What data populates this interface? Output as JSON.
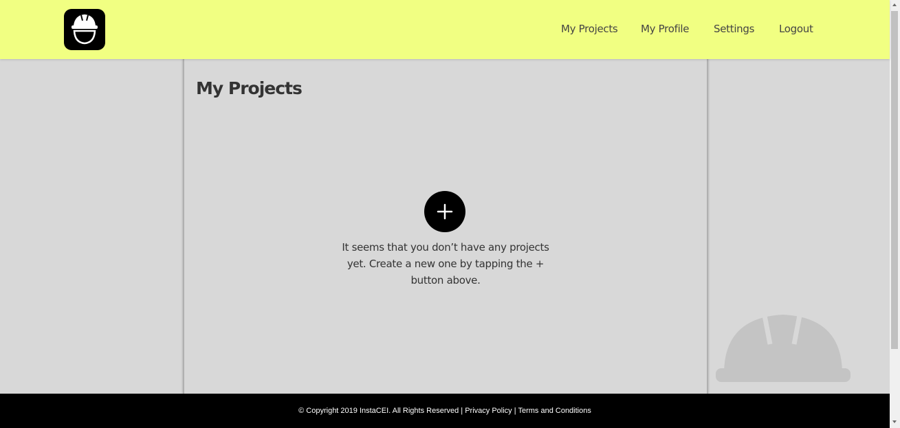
{
  "nav": {
    "items": [
      {
        "label": "My Projects"
      },
      {
        "label": "My Profile"
      },
      {
        "label": "Settings"
      },
      {
        "label": "Logout"
      }
    ]
  },
  "main": {
    "title": "My Projects",
    "add_button_icon": "plus-icon",
    "empty_message": "It seems that you don’t have any projects yet. Create a new one by tapping the + button above."
  },
  "footer": {
    "copyright": "© Copyright 2019 InstaCEI. All Rights Reserved |",
    "privacy": "Privacy Policy",
    "separator": "|",
    "terms": "Terms and Conditions"
  },
  "colors": {
    "header_bg": "#f1ff82",
    "page_bg": "#d8d8d8",
    "footer_bg": "#000000",
    "accent": "#000000"
  }
}
